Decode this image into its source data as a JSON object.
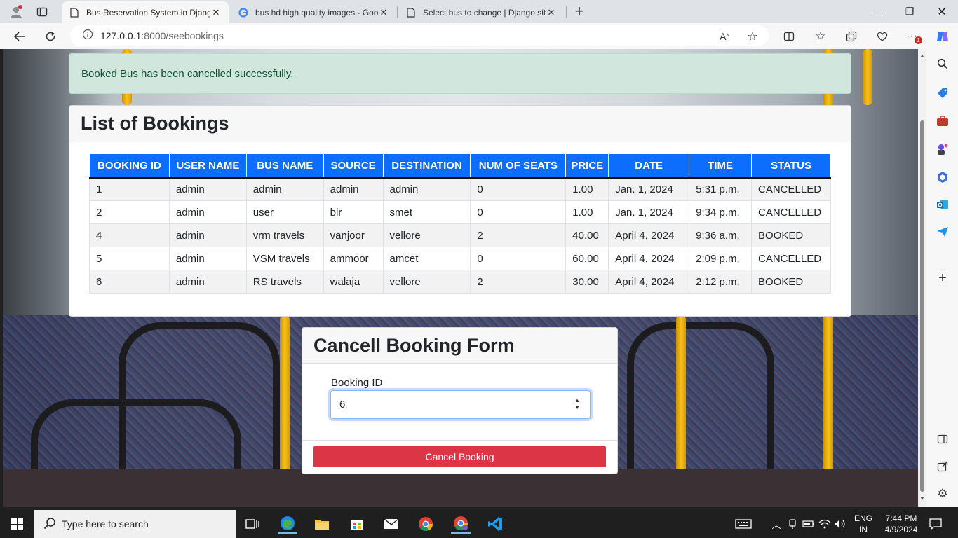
{
  "browser": {
    "tabs": [
      {
        "title": "Bus Reservation System in Djang",
        "active": true
      },
      {
        "title": "bus hd high quality images - Goo",
        "active": false
      },
      {
        "title": "Select bus to change | Django sit",
        "active": false
      }
    ],
    "url_host": "127.0.0.1",
    "url_path": ":8000/seebookings",
    "notification_count": "1"
  },
  "alert": {
    "message": "Booked Bus has been cancelled successfully."
  },
  "bookings": {
    "title": "List of Bookings",
    "columns": [
      "BOOKING ID",
      "USER NAME",
      "BUS NAME",
      "SOURCE",
      "DESTINATION",
      "NUM OF SEATS",
      "PRICE",
      "DATE",
      "TIME",
      "STATUS"
    ],
    "rows": [
      [
        "1",
        "admin",
        "admin",
        "admin",
        "admin",
        "0",
        "1.00",
        "Jan. 1, 2024",
        "5:31 p.m.",
        "CANCELLED"
      ],
      [
        "2",
        "admin",
        "user",
        "blr",
        "smet",
        "0",
        "1.00",
        "Jan. 1, 2024",
        "9:34 p.m.",
        "CANCELLED"
      ],
      [
        "4",
        "admin",
        "vrm travels",
        "vanjoor",
        "vellore",
        "2",
        "40.00",
        "April 4, 2024",
        "9:36 a.m.",
        "BOOKED"
      ],
      [
        "5",
        "admin",
        "VSM travels",
        "ammoor",
        "amcet",
        "0",
        "60.00",
        "April 4, 2024",
        "2:09 p.m.",
        "CANCELLED"
      ],
      [
        "6",
        "admin",
        "RS travels",
        "walaja",
        "vellore",
        "2",
        "30.00",
        "April 4, 2024",
        "2:12 p.m.",
        "BOOKED"
      ]
    ]
  },
  "cancel_form": {
    "title": "Cancell Booking Form",
    "field_label": "Booking ID",
    "field_value": "6",
    "submit_label": "Cancel Booking"
  },
  "taskbar": {
    "search_placeholder": "Type here to search",
    "lang_top": "ENG",
    "lang_bottom": "IN",
    "time": "7:44 PM",
    "date": "4/9/2024"
  },
  "colors": {
    "primary": "#0d6efd",
    "danger": "#dc3545",
    "success_bg": "#d1e7dd",
    "success_text": "#0f5132"
  }
}
